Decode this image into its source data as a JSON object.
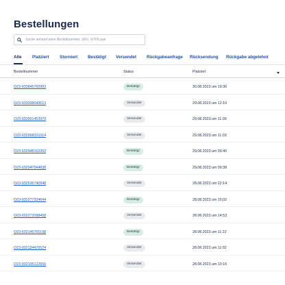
{
  "page": {
    "title": "Bestellungen"
  },
  "search": {
    "placeholder": "Suche anhand einer Bestellnummer, SKU, GTIN usw."
  },
  "tabs": [
    {
      "label": "Alle",
      "active": true
    },
    {
      "label": "Platziert",
      "active": false
    },
    {
      "label": "Storniert",
      "active": false
    },
    {
      "label": "Bestätigt",
      "active": false
    },
    {
      "label": "Versendet",
      "active": false
    },
    {
      "label": "Rückgabeanfrage",
      "active": false
    },
    {
      "label": "Rücksendung",
      "active": false
    },
    {
      "label": "Rückgabe abgelehnt",
      "active": false
    }
  ],
  "table": {
    "columns": {
      "order": "Bestellnummer",
      "status": "Status",
      "date": "Platziert"
    },
    "rows": [
      {
        "order": "O23-933845760903",
        "status": "Bestätigt",
        "date": "30.08.2023 um 10:36"
      },
      {
        "order": "O23-933038040613",
        "status": "Versendet",
        "date": "29.08.2023 um 12:10"
      },
      {
        "order": "O23-933001453979",
        "status": "Versendet",
        "date": "29.08.2023 um 11:09"
      },
      {
        "order": "O23-932998321014",
        "status": "Versendet",
        "date": "29.08.2023 um 11:03"
      },
      {
        "order": "O23-932948162353",
        "status": "Bestätigt",
        "date": "29.08.2023 um 09:40"
      },
      {
        "order": "O23-932947044838",
        "status": "Bestätigt",
        "date": "29.08.2023 um 09:38"
      },
      {
        "order": "O23-932536740948",
        "status": "Versendet",
        "date": "28.08.2023 um 22:14"
      },
      {
        "order": "O23-932277324644",
        "status": "Bestätigt",
        "date": "28.08.2023 um 15:02"
      },
      {
        "order": "O23-932272098458",
        "status": "Versendet",
        "date": "28.08.2023 um 14:53"
      },
      {
        "order": "O23-932145765198",
        "status": "Bestätigt",
        "date": "28.08.2023 um 11:22"
      },
      {
        "order": "O23-932134476574",
        "status": "Versendet",
        "date": "28.08.2023 um 11:02"
      },
      {
        "order": "O23-932106122655",
        "status": "Versendet",
        "date": "28.08.2023 um 10:16"
      }
    ]
  },
  "colors": {
    "title": "#1b2a4e",
    "tab_link": "#1e4f9e",
    "order_link": "#1a5dc8",
    "badge_confirmed_bg": "#d8ece6",
    "badge_shipped_bg": "#e8eaed"
  },
  "icons": {
    "search": "search-icon",
    "sort": "sort-down-icon"
  }
}
